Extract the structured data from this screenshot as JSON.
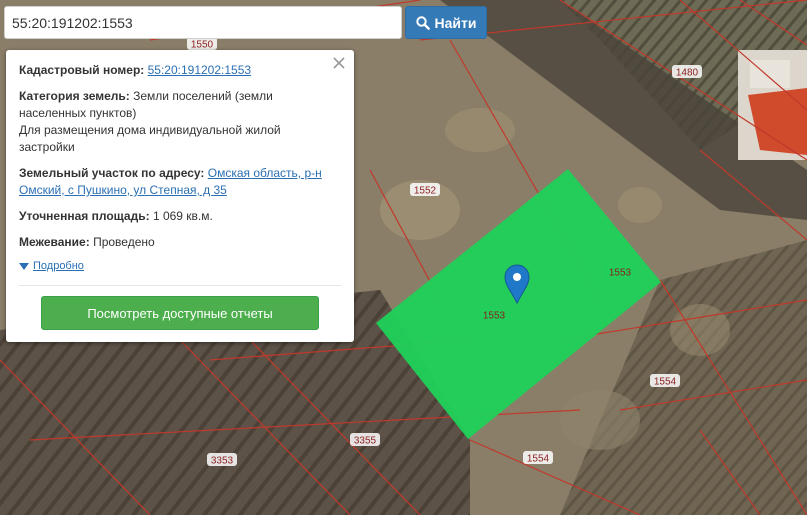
{
  "search": {
    "value": "55:20:191202:1553",
    "button_label": "Найти",
    "icon": "search-icon"
  },
  "popup": {
    "cadastral_label": "Кадастровый номер:",
    "cadastral_value": "55:20:191202:1553",
    "category_label": "Категория земель:",
    "category_value_1": "Земли поселений (земли",
    "category_value_2": "населенных пунктов)",
    "category_value_3": "Для размещения дома индивидуальной жилой",
    "category_value_4": "застройки",
    "address_label": "Земельный участок по адресу:",
    "address_line_1": "Омская область, р-н",
    "address_line_2": "Омский, с Пушкино, ул Степная, д 35",
    "area_label": "Уточненная площадь:",
    "area_value": "1 069 кв.м.",
    "survey_label": "Межевание:",
    "survey_value": "Проведено",
    "more_label": "Подробно",
    "report_button": "Посмотреть доступные отчеты"
  },
  "map": {
    "parcel_labels": [
      "1550",
      "1480",
      "1552",
      "1553",
      "1553",
      "1554",
      "1554",
      "3355",
      "3353"
    ],
    "selected_color": "#1fd15a",
    "border_color": "#c0392b"
  }
}
